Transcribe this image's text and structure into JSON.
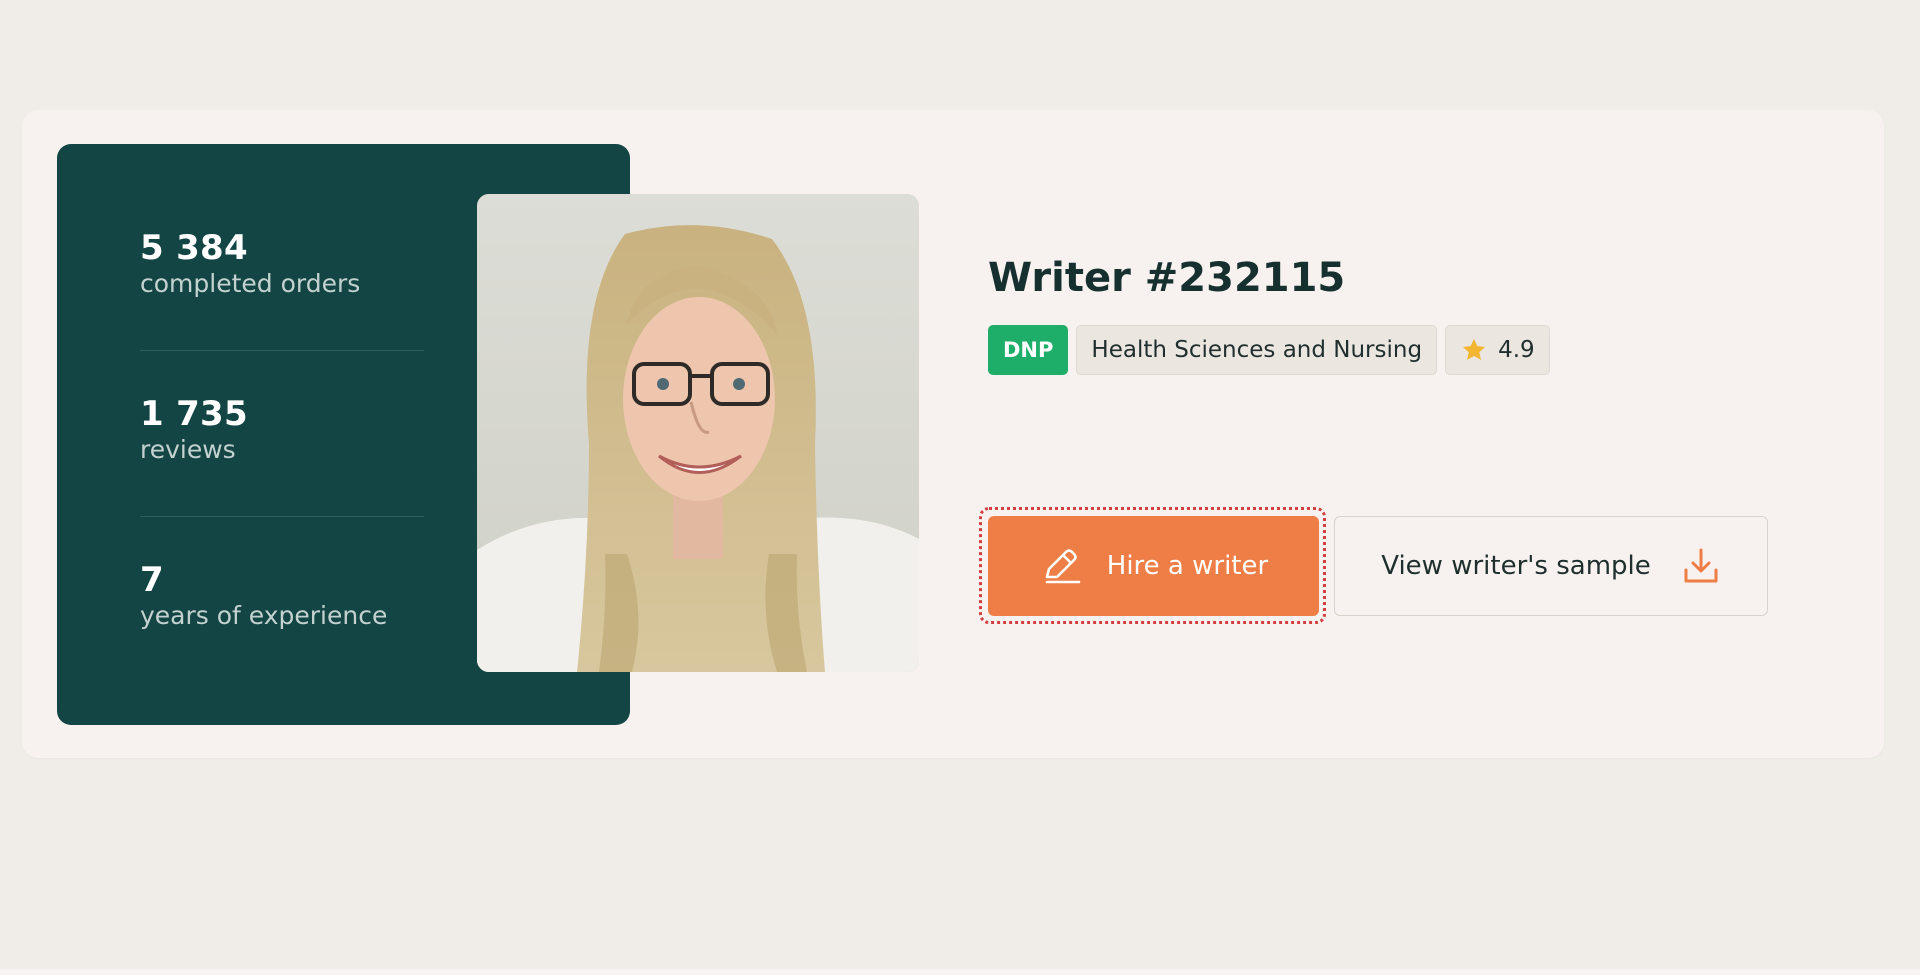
{
  "colors": {
    "page_background": "#f0ece8",
    "card_background": "#f7f2ef",
    "stats_panel": "#134544",
    "degree_badge": "#1fae6a",
    "accent_orange": "#ee7d46",
    "star": "#f2b632"
  },
  "stats": [
    {
      "value": "5 384",
      "label": "completed orders"
    },
    {
      "value": "1 735",
      "label": "reviews"
    },
    {
      "value": "7",
      "label": "years of experience"
    }
  ],
  "writer": {
    "title": "Writer #232115",
    "degree": "DNP",
    "field": "Health Sciences and Nursing",
    "rating": "4.9"
  },
  "actions": {
    "hire_label": "Hire a writer",
    "hire_icon": "pencil-icon",
    "sample_label": "View writer's sample",
    "sample_icon": "download-icon"
  },
  "icons": {
    "rating": "star-icon"
  }
}
